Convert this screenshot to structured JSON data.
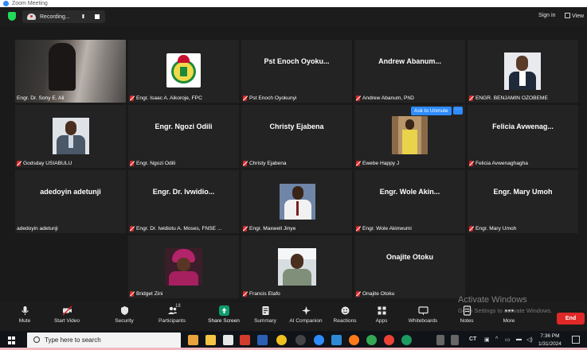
{
  "window": {
    "title": "Zoom Meeting"
  },
  "topbar": {
    "recording_label": "Recording...",
    "signin_label": "Sign in",
    "view_label": "View",
    "colors": {
      "security_shield": "#23d959",
      "record_dot": "#e02828"
    }
  },
  "tiles": [
    {
      "display_name": "",
      "label": "Engr. Dr. Sony E. Ali",
      "muted": false,
      "active": true
    },
    {
      "display_name": "",
      "label": "Engr. Isaac A. Aikoroje, FPC",
      "muted": true
    },
    {
      "display_name": "Pst Enoch Oyoku...",
      "label": "Pst Enoch Oyokunyi",
      "muted": true
    },
    {
      "display_name": "Andrew  Abanum...",
      "label": "Andrew Abanum, PhD",
      "muted": true
    },
    {
      "display_name": "",
      "label": "ENGR. BENJAMIN OZOBEME",
      "muted": true
    },
    {
      "display_name": "",
      "label": "Godsday USIABULU",
      "muted": true
    },
    {
      "display_name": "Engr. Ngozi Odili",
      "label": "Engr. Ngozi Odili",
      "muted": true
    },
    {
      "display_name": "Christy Ejabena",
      "label": "Christy Ejabena",
      "muted": true
    },
    {
      "display_name": "",
      "label": "Ewebe Happy J",
      "muted": true,
      "ask_to_unmute": "Ask to Unmute",
      "more": "···"
    },
    {
      "display_name": "Felicia  Avwenag...",
      "label": "Felicia Avwenaghagha",
      "muted": true
    },
    {
      "display_name": "adedoyin  adetunji",
      "label": "adedoyin  adetunji",
      "muted": false
    },
    {
      "display_name": "Engr. Dr. Ivwidio...",
      "label": "Engr. Dr. Iwidiotu A. Moses, FNSE ...",
      "muted": true
    },
    {
      "display_name": "",
      "label": "Engr. Maxwell Jinye",
      "muted": true
    },
    {
      "display_name": "Engr. Wole  Akin...",
      "label": "Engr. Wole Akinwumi",
      "muted": true
    },
    {
      "display_name": "Engr. Mary Umoh",
      "label": "Engr. Mary Umoh",
      "muted": true
    },
    {
      "display_name": "",
      "label": "Bridget Zini",
      "muted": true
    },
    {
      "display_name": "",
      "label": "Francis Etafo",
      "muted": true
    },
    {
      "display_name": "Onajite Otoku",
      "label": "Onajite Otoku",
      "muted": true
    }
  ],
  "toolbar": {
    "mute": "Mute",
    "start_video": "Start Video",
    "security": "Security",
    "participants": "Participants",
    "participants_count": "18",
    "share_screen": "Share Screen",
    "summary": "Summary",
    "ai_companion": "AI Companion",
    "reactions": "Reactions",
    "apps": "Apps",
    "whiteboards": "Whiteboards",
    "notes": "Notes",
    "more": "More",
    "end": "End",
    "colors": {
      "share": "#0e9d6a",
      "end": "#e02828",
      "ask_unmute": "#2d8cff",
      "active_speaker": "#c7e86a"
    }
  },
  "watermark": {
    "line1": "Activate Windows",
    "line2": "Go to Settings to activate Windows."
  },
  "taskbar": {
    "search_placeholder": "Type here to search",
    "language": "CT",
    "time": "7:36 PM",
    "date": "1/31/2024"
  }
}
